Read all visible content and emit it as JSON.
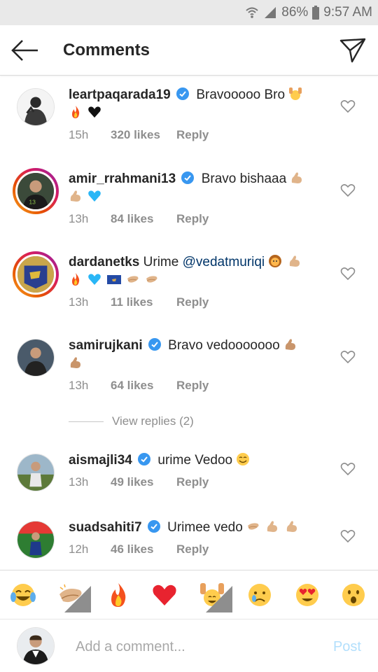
{
  "status_bar": {
    "battery": "86%",
    "time": "9:57 AM"
  },
  "header": {
    "title": "Comments"
  },
  "comments": [
    {
      "username": "leartpaqarada19",
      "verified": true,
      "text": "Bravooooo Bro",
      "time": "15h",
      "likes": "320 likes",
      "reply": "Reply"
    },
    {
      "username": "amir_rrahmani13",
      "verified": true,
      "text": "Bravo bishaaa",
      "time": "13h",
      "likes": "84 likes",
      "reply": "Reply"
    },
    {
      "username": "dardanetks",
      "verified": false,
      "text": "Urime",
      "mention": "@vedatmuriqi",
      "time": "13h",
      "likes": "11 likes",
      "reply": "Reply"
    },
    {
      "username": "samirujkani",
      "verified": true,
      "text": "Bravo vedooooooo",
      "time": "13h",
      "likes": "64 likes",
      "reply": "Reply"
    },
    {
      "username": "aismajli34",
      "verified": true,
      "text": "urime Vedoo",
      "time": "13h",
      "likes": "49 likes",
      "reply": "Reply"
    },
    {
      "username": "suadsahiti7",
      "verified": true,
      "text": "Urimee vedo",
      "time": "12h",
      "likes": "46 likes",
      "reply": "Reply"
    }
  ],
  "view_replies": "View replies (2)",
  "emoji_bar": [
    "face-with-tears-of-joy",
    "clapping-hands",
    "fire",
    "red-heart",
    "raising-hands",
    "crying-face",
    "heart-eyes",
    "astonished-face"
  ],
  "input": {
    "placeholder": "Add a comment...",
    "post_label": "Post"
  },
  "colors": {
    "mention": "#003569",
    "verified": "#3897f0",
    "post_disabled": "#b2dffc",
    "meta": "#8e8e8e"
  }
}
